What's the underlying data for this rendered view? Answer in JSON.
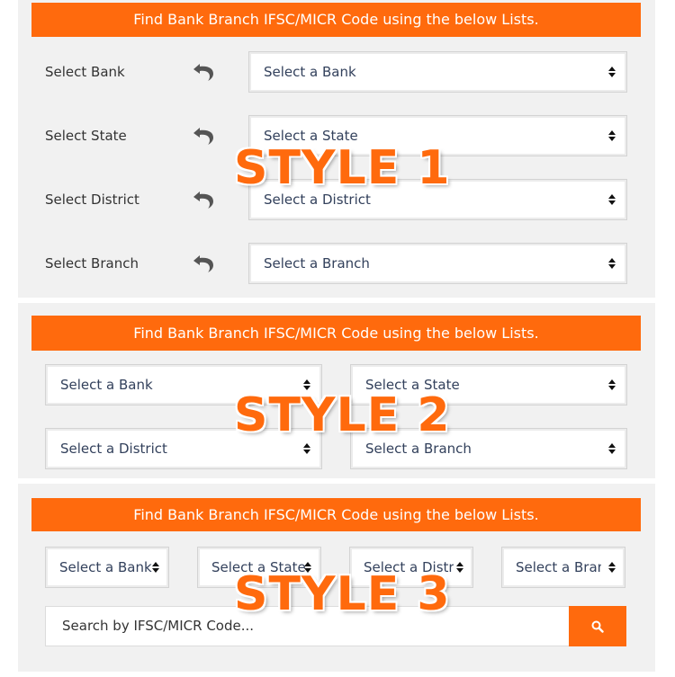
{
  "banner_text": "Find Bank Branch IFSC/MICR Code using the below Lists.",
  "style1": {
    "tag": "STYLE 1",
    "rows": [
      {
        "label": "Select Bank",
        "select": "Select a Bank"
      },
      {
        "label": "Select State",
        "select": "Select a State"
      },
      {
        "label": "Select District",
        "select": "Select a District"
      },
      {
        "label": "Select Branch",
        "select": "Select a Branch"
      }
    ]
  },
  "style2": {
    "tag": "STYLE 2",
    "selects": [
      "Select a Bank",
      "Select a State",
      "Select a District",
      "Select a Branch"
    ]
  },
  "style3": {
    "tag": "STYLE 3",
    "selects": [
      "Select a Bank",
      "Select a State",
      "Select a District",
      "Select a Branch"
    ],
    "search_placeholder": "Search by IFSC/MICR Code..."
  },
  "colors": {
    "accent": "#ff6a0d",
    "panel_bg": "#f1f1f1"
  }
}
